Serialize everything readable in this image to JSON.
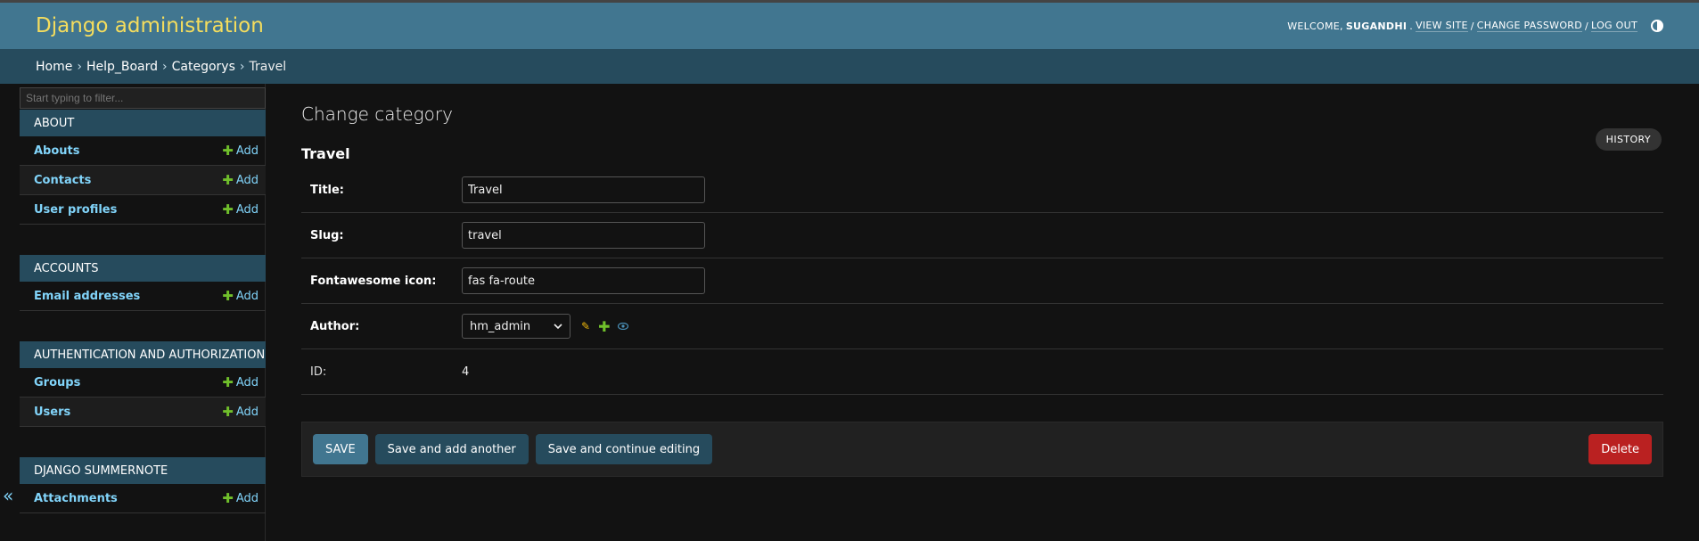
{
  "header": {
    "brand": "Django administration",
    "welcome": "WELCOME,",
    "username": "SUGANDHI",
    "period": ".",
    "view_site": "VIEW SITE",
    "sep1": "/",
    "change_password": "CHANGE PASSWORD",
    "sep2": "/",
    "log_out": "LOG OUT"
  },
  "breadcrumbs": {
    "items": [
      "Home",
      "Help_Board",
      "Categorys",
      "Travel"
    ],
    "sep": "›"
  },
  "sidebar": {
    "filter_placeholder": "Start typing to filter...",
    "collapse_glyph": "«",
    "modules": [
      {
        "caption": "ABOUT",
        "models": [
          {
            "name": "Abouts",
            "add": "Add"
          },
          {
            "name": "Contacts",
            "add": "Add"
          },
          {
            "name": "User profiles",
            "add": "Add"
          }
        ]
      },
      {
        "caption": "ACCOUNTS",
        "models": [
          {
            "name": "Email addresses",
            "add": "Add"
          }
        ]
      },
      {
        "caption": "AUTHENTICATION AND AUTHORIZATION",
        "models": [
          {
            "name": "Groups",
            "add": "Add"
          },
          {
            "name": "Users",
            "add": "Add"
          }
        ]
      },
      {
        "caption": "DJANGO SUMMERNOTE",
        "models": [
          {
            "name": "Attachments",
            "add": "Add"
          }
        ]
      }
    ]
  },
  "content": {
    "title": "Change category",
    "object_title": "Travel",
    "history": "HISTORY",
    "fields": {
      "title_label": "Title:",
      "title_value": "Travel",
      "slug_label": "Slug:",
      "slug_value": "travel",
      "icon_label": "Fontawesome icon:",
      "icon_value": "fas fa-route",
      "author_label": "Author:",
      "author_value": "hm_admin",
      "id_label": "ID:",
      "id_value": "4"
    },
    "buttons": {
      "save": "SAVE",
      "save_add_another": "Save and add another",
      "save_continue": "Save and continue editing",
      "delete": "Delete"
    }
  },
  "colors": {
    "header_bg": "#417690",
    "brand": "#f5dd5d",
    "breadcrumb_bg": "#264b5d",
    "link": "#81d4fa",
    "add_icon": "#70bf2b",
    "delete": "#ba2121"
  },
  "icons": {
    "theme_toggle": "contrast-icon",
    "add": "plus-icon",
    "change_related": "pencil-icon",
    "add_related": "plus-icon",
    "view_related": "eye-icon",
    "select_arrow": "chevron-down-icon",
    "collapse": "double-chevron-left-icon"
  }
}
